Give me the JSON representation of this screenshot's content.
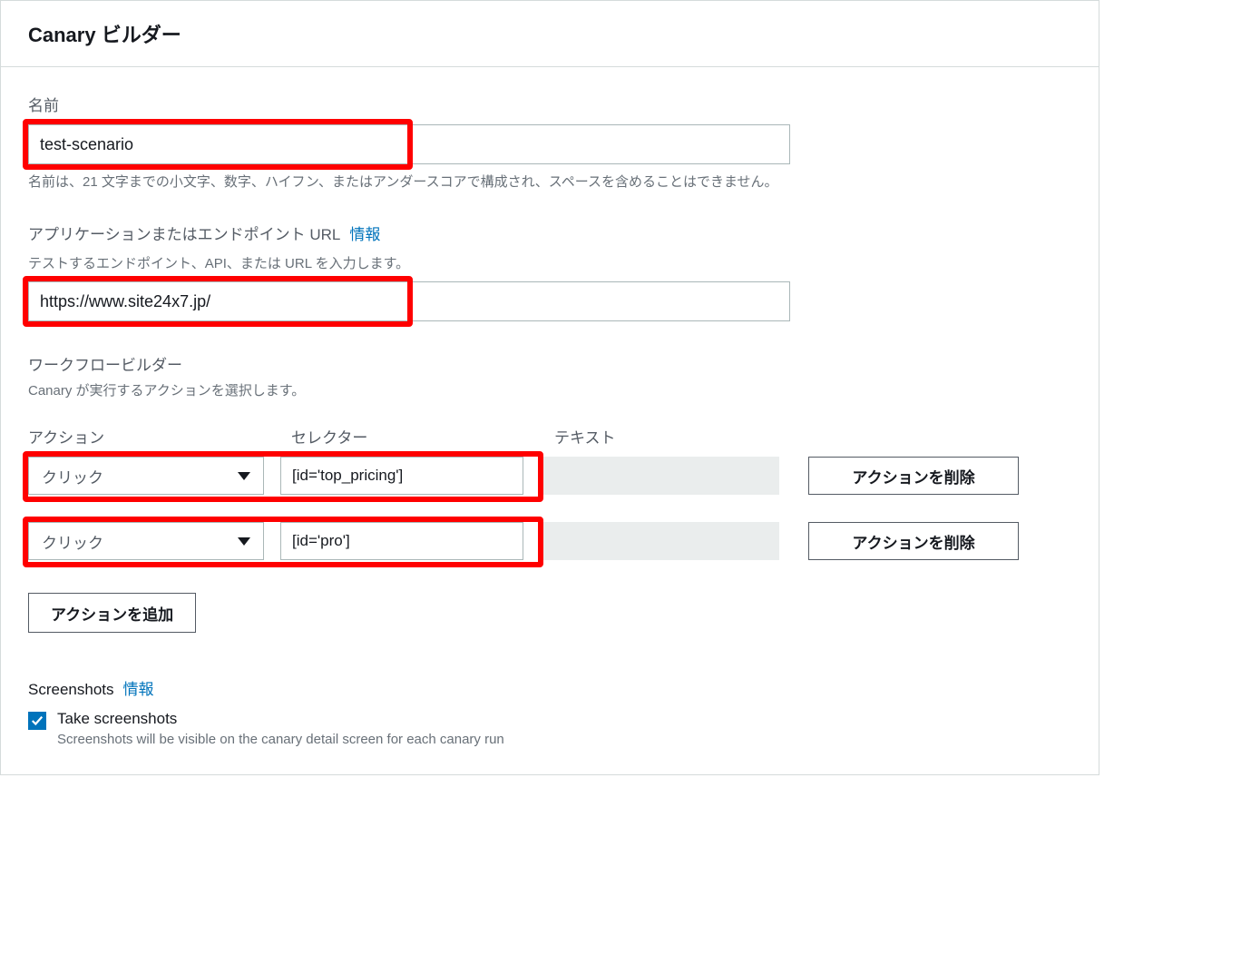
{
  "header": {
    "title": "Canary ビルダー"
  },
  "name": {
    "label": "名前",
    "value": "test-scenario",
    "hint": "名前は、21 文字までの小文字、数字、ハイフン、またはアンダースコアで構成され、スペースを含めることはできません。"
  },
  "url": {
    "label": "アプリケーションまたはエンドポイント URL",
    "info": "情報",
    "hint": "テストするエンドポイント、API、または URL を入力します。",
    "value": "https://www.site24x7.jp/"
  },
  "workflow": {
    "title": "ワークフロービルダー",
    "hint": "Canary が実行するアクションを選択します。",
    "cols": {
      "action": "アクション",
      "selector": "セレクター",
      "text": "テキスト"
    },
    "rows": [
      {
        "action": "クリック",
        "selector": "[id='top_pricing']",
        "delete": "アクションを削除"
      },
      {
        "action": "クリック",
        "selector": "[id='pro']",
        "delete": "アクションを削除"
      }
    ],
    "add": "アクションを追加"
  },
  "screenshots": {
    "label": "Screenshots",
    "info": "情報",
    "checkbox_label": "Take screenshots",
    "checkbox_hint": "Screenshots will be visible on the canary detail screen for each canary run"
  }
}
